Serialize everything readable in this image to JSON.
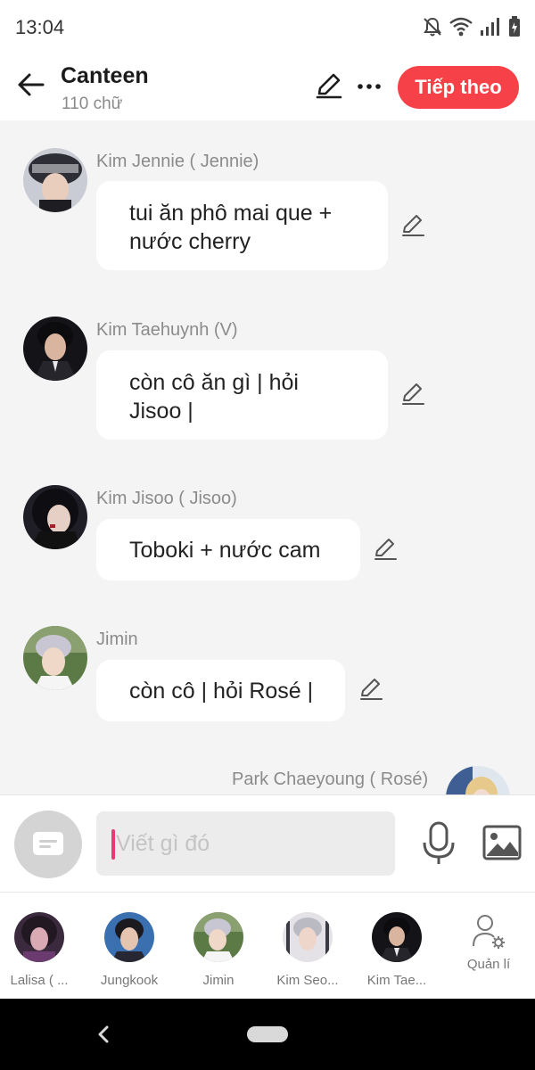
{
  "status_bar": {
    "time": "13:04"
  },
  "header": {
    "title": "Canteen",
    "subtitle": "110 chữ",
    "next_label": "Tiếp theo"
  },
  "messages": [
    {
      "sender": "Kim Jennie ( Jennie)",
      "text": "tui ăn phô mai que + nước cherry"
    },
    {
      "sender": "Kim Taehuynh (V)",
      "text": "còn cô ăn gì | hỏi Jisoo |"
    },
    {
      "sender": "Kim Jisoo ( Jisoo)",
      "text": "Toboki + nước cam"
    },
    {
      "sender": "Jimin",
      "text": "còn cô | hỏi Rosé |"
    },
    {
      "sender": "Park Chaeyoung ( Rosé)",
      "text": ""
    }
  ],
  "composer": {
    "placeholder": "Viết gì đó"
  },
  "roster": {
    "members": [
      "Lalisa ( ...",
      "Jungkook",
      "Jimin",
      "Kim Seo...",
      "Kim Tae..."
    ],
    "manage_label": "Quản lí"
  },
  "colors": {
    "accent": "#f74149",
    "caret": "#e83a72",
    "background": "#f4f4f5"
  }
}
